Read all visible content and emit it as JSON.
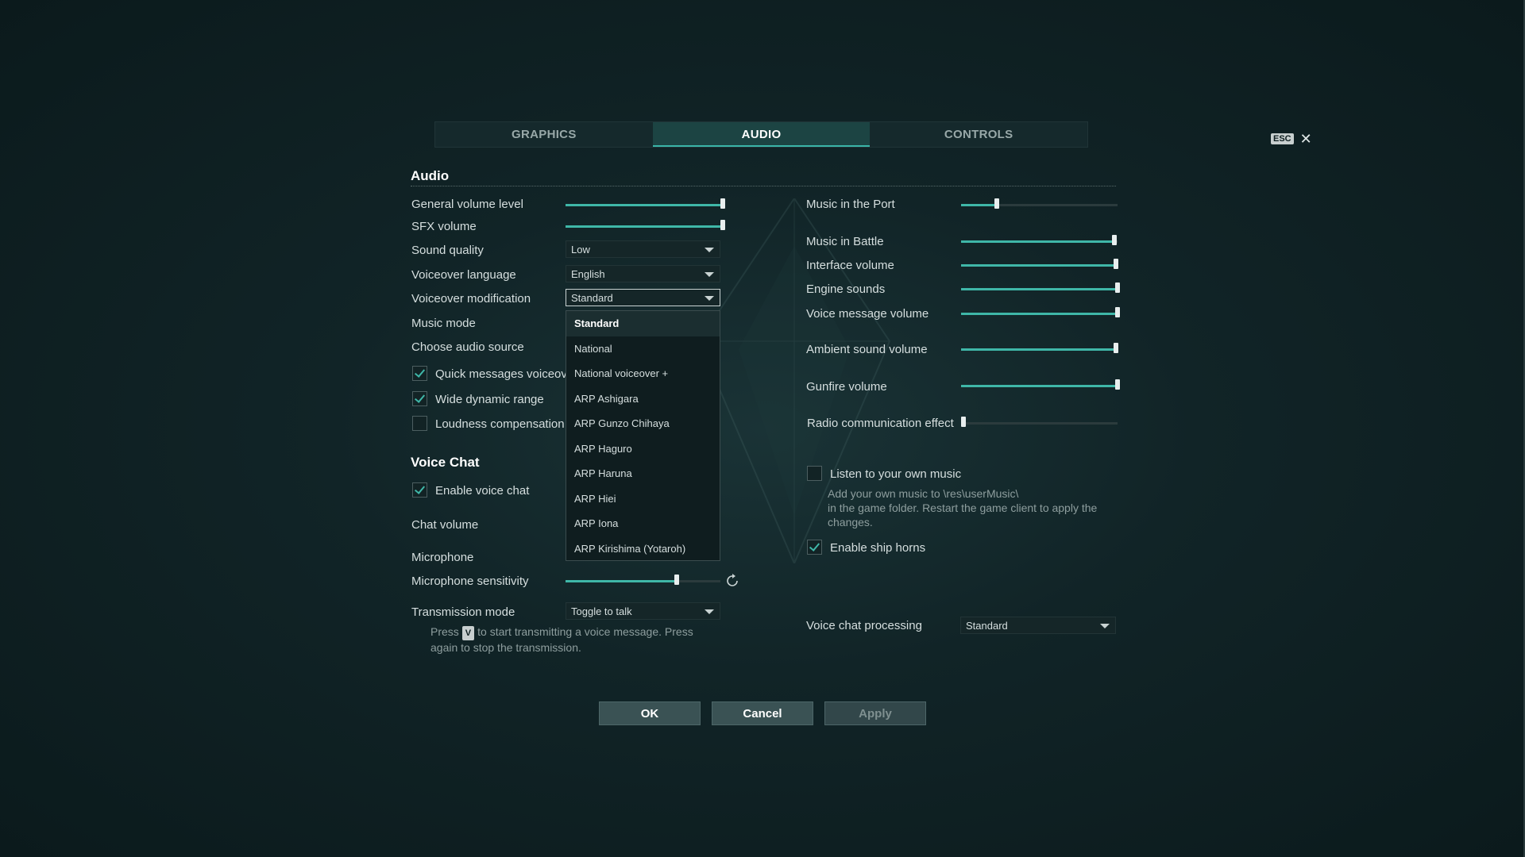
{
  "tabs": [
    {
      "label": "GRAPHICS",
      "active": false
    },
    {
      "label": "AUDIO",
      "active": true
    },
    {
      "label": "CONTROLS",
      "active": false
    }
  ],
  "close": {
    "key": "ESC",
    "glyph": "✕"
  },
  "audio": {
    "title": "Audio",
    "general_volume": {
      "label": "General volume level",
      "value": 1.0
    },
    "sfx_volume": {
      "label": "SFX volume",
      "value": 1.0
    },
    "sound_quality": {
      "label": "Sound quality",
      "value": "Low"
    },
    "voiceover_language": {
      "label": "Voiceover language",
      "value": "English"
    },
    "voiceover_modification": {
      "label": "Voiceover modification",
      "value": "Standard"
    },
    "music_mode": {
      "label": "Music mode"
    },
    "audio_source": {
      "label": "Choose audio source"
    },
    "quick_messages": {
      "label": "Quick messages voiceover",
      "checked": true
    },
    "wide_dynamic": {
      "label": "Wide dynamic range",
      "checked": true
    },
    "loudness": {
      "label": "Loudness compensation",
      "checked": false
    }
  },
  "voiceover_options": [
    "Standard",
    "National",
    "National voiceover +",
    "ARP Ashigara",
    "ARP Gunzo Chihaya",
    "ARP Haguro",
    "ARP Haruna",
    "ARP Hiei",
    "ARP Iona",
    "ARP Kirishima (Yotaroh)"
  ],
  "voice_chat": {
    "title": "Voice Chat",
    "enable": {
      "label": "Enable voice chat",
      "checked": true
    },
    "chat_volume": {
      "label": "Chat volume"
    },
    "microphone": {
      "label": "Microphone"
    },
    "mic_sensitivity": {
      "label": "Microphone sensitivity",
      "value": 0.72
    },
    "transmission": {
      "label": "Transmission mode",
      "value": "Toggle to talk"
    },
    "hint_press": "Press",
    "hint_key": "V",
    "hint_rest": "to start transmitting a voice message. Press",
    "hint_line2": "again to stop the transmission."
  },
  "right": {
    "music_port": {
      "label": "Music in the Port",
      "value": 0.23
    },
    "music_battle": {
      "label": "Music in Battle",
      "value": 0.98
    },
    "interface_volume": {
      "label": "Interface volume",
      "value": 0.99
    },
    "engine_sounds": {
      "label": "Engine sounds",
      "value": 1.0
    },
    "voice_message": {
      "label": "Voice message volume",
      "value": 1.0
    },
    "ambient": {
      "label": "Ambient sound volume",
      "value": 0.99
    },
    "gunfire": {
      "label": "Gunfire volume",
      "value": 1.0
    },
    "radio_effect": {
      "label": "Radio communication effect",
      "value": 0.0
    },
    "own_music": {
      "label": "Listen to your own music",
      "checked": false,
      "hint1": "Add your own music to \\res\\userMusic\\",
      "hint2": "in the game folder. Restart the game client to apply the",
      "hint3": "changes."
    },
    "ship_horns": {
      "label": "Enable ship horns",
      "checked": true
    },
    "vc_processing": {
      "label": "Voice chat processing",
      "value": "Standard"
    }
  },
  "buttons": {
    "ok": "OK",
    "cancel": "Cancel",
    "apply": "Apply"
  },
  "colors": {
    "accent": "#3fb7a8",
    "background": "#112427"
  }
}
